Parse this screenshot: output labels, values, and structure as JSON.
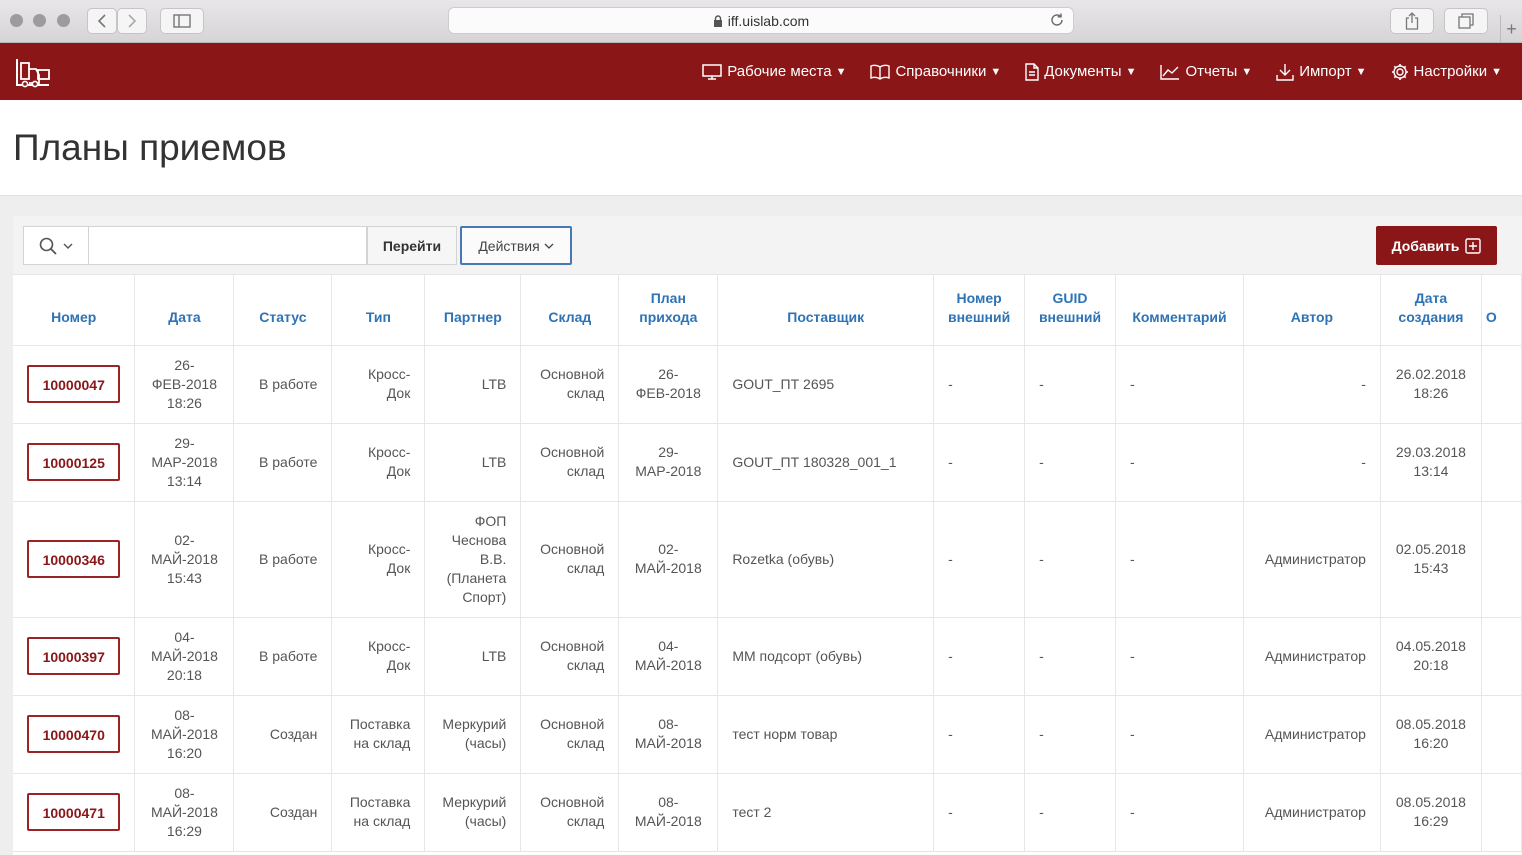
{
  "browser": {
    "url": "iff.uislab.com"
  },
  "nav": {
    "items": [
      {
        "label": "Рабочие места",
        "icon": "monitor-icon"
      },
      {
        "label": "Справочники",
        "icon": "book-icon"
      },
      {
        "label": "Документы",
        "icon": "document-icon"
      },
      {
        "label": "Отчеты",
        "icon": "chart-icon"
      },
      {
        "label": "Импорт",
        "icon": "download-icon"
      },
      {
        "label": "Настройки",
        "icon": "gear-icon"
      }
    ],
    "caret": "▼"
  },
  "page": {
    "title": "Планы приемов"
  },
  "toolbar": {
    "go_label": "Перейти",
    "actions_label": "Действия",
    "add_label": "Добавить",
    "search_value": ""
  },
  "table": {
    "headers": [
      "Номер",
      "Дата",
      "Статус",
      "Тип",
      "Партнер",
      "Склад",
      "План прихода",
      "Поставщик",
      "Номер внешний",
      "GUID внешний",
      "Комментарий",
      "Автор",
      "Дата создания",
      "О"
    ],
    "rows": [
      {
        "number": "10000047",
        "date": "26-ФЕВ-2018 18:26",
        "status": "В работе",
        "type": "Кросс-Док",
        "partner": "LTB",
        "warehouse": "Основной склад",
        "plan": "26-ФЕВ-2018",
        "supplier": "GOUT_ПТ 2695",
        "ext_num": "-",
        "guid": "-",
        "comment": "-",
        "author": "-",
        "created": "26.02.2018 18:26"
      },
      {
        "number": "10000125",
        "date": "29-МАР-2018 13:14",
        "status": "В работе",
        "type": "Кросс-Док",
        "partner": "LTB",
        "warehouse": "Основной склад",
        "plan": "29-МАР-2018",
        "supplier": "GOUT_ПТ 180328_001_1",
        "ext_num": "-",
        "guid": "-",
        "comment": "-",
        "author": "-",
        "created": "29.03.2018 13:14"
      },
      {
        "number": "10000346",
        "date": "02-МАЙ-2018 15:43",
        "status": "В работе",
        "type": "Кросс-Док",
        "partner": "ФОП Чеснова В.В. (Планета Спорт)",
        "warehouse": "Основной склад",
        "plan": "02-МАЙ-2018",
        "supplier": "Rozetka (обувь)",
        "ext_num": "-",
        "guid": "-",
        "comment": "-",
        "author": "Администратор",
        "created": "02.05.2018 15:43"
      },
      {
        "number": "10000397",
        "date": "04-МАЙ-2018 20:18",
        "status": "В работе",
        "type": "Кросс-Док",
        "partner": "LTB",
        "warehouse": "Основной склад",
        "plan": "04-МАЙ-2018",
        "supplier": "ММ подсорт (обувь)",
        "ext_num": "-",
        "guid": "-",
        "comment": "-",
        "author": "Администратор",
        "created": "04.05.2018 20:18"
      },
      {
        "number": "10000470",
        "date": "08-МАЙ-2018 16:20",
        "status": "Создан",
        "type": "Поставка на склад",
        "partner": "Меркурий (часы)",
        "warehouse": "Основной склад",
        "plan": "08-МАЙ-2018",
        "supplier": "тест норм товар",
        "ext_num": "-",
        "guid": "-",
        "comment": "-",
        "author": "Администратор",
        "created": "08.05.2018 16:20"
      },
      {
        "number": "10000471",
        "date": "08-МАЙ-2018 16:29",
        "status": "Создан",
        "type": "Поставка на склад",
        "partner": "Меркурий (часы)",
        "warehouse": "Основной склад",
        "plan": "08-МАЙ-2018",
        "supplier": "тест 2",
        "ext_num": "-",
        "guid": "-",
        "comment": "-",
        "author": "Администратор",
        "created": "08.05.2018 16:29"
      }
    ]
  },
  "colors": {
    "brand": "#8a1618",
    "header_text": "#2e73b6",
    "focus_border": "#4678b4"
  }
}
